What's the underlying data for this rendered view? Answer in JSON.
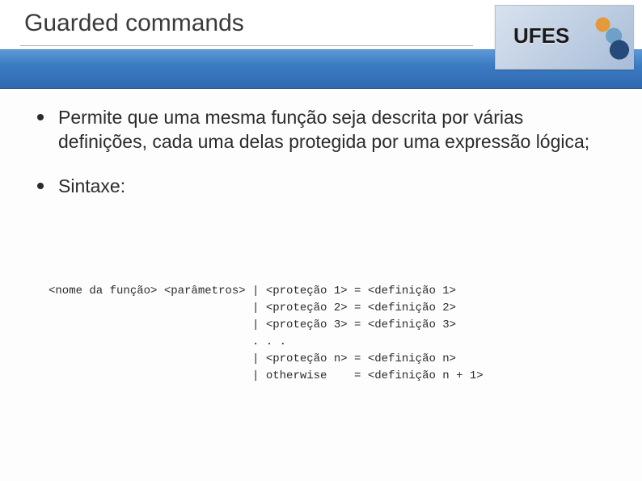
{
  "header": {
    "title": "Guarded commands",
    "logo_text": "UFES"
  },
  "bullets": [
    "Permite que uma mesma função seja descrita por várias definições, cada uma delas protegida por uma expressão lógica;",
    "Sintaxe:"
  ],
  "code": "<nome da função> <parâmetros> | <proteção 1> = <definição 1>\n                              | <proteção 2> = <definição 2>\n                              | <proteção 3> = <definição 3>\n                              . . .\n                              | <proteção n> = <definição n>\n                              | otherwise    = <definição n + 1>"
}
